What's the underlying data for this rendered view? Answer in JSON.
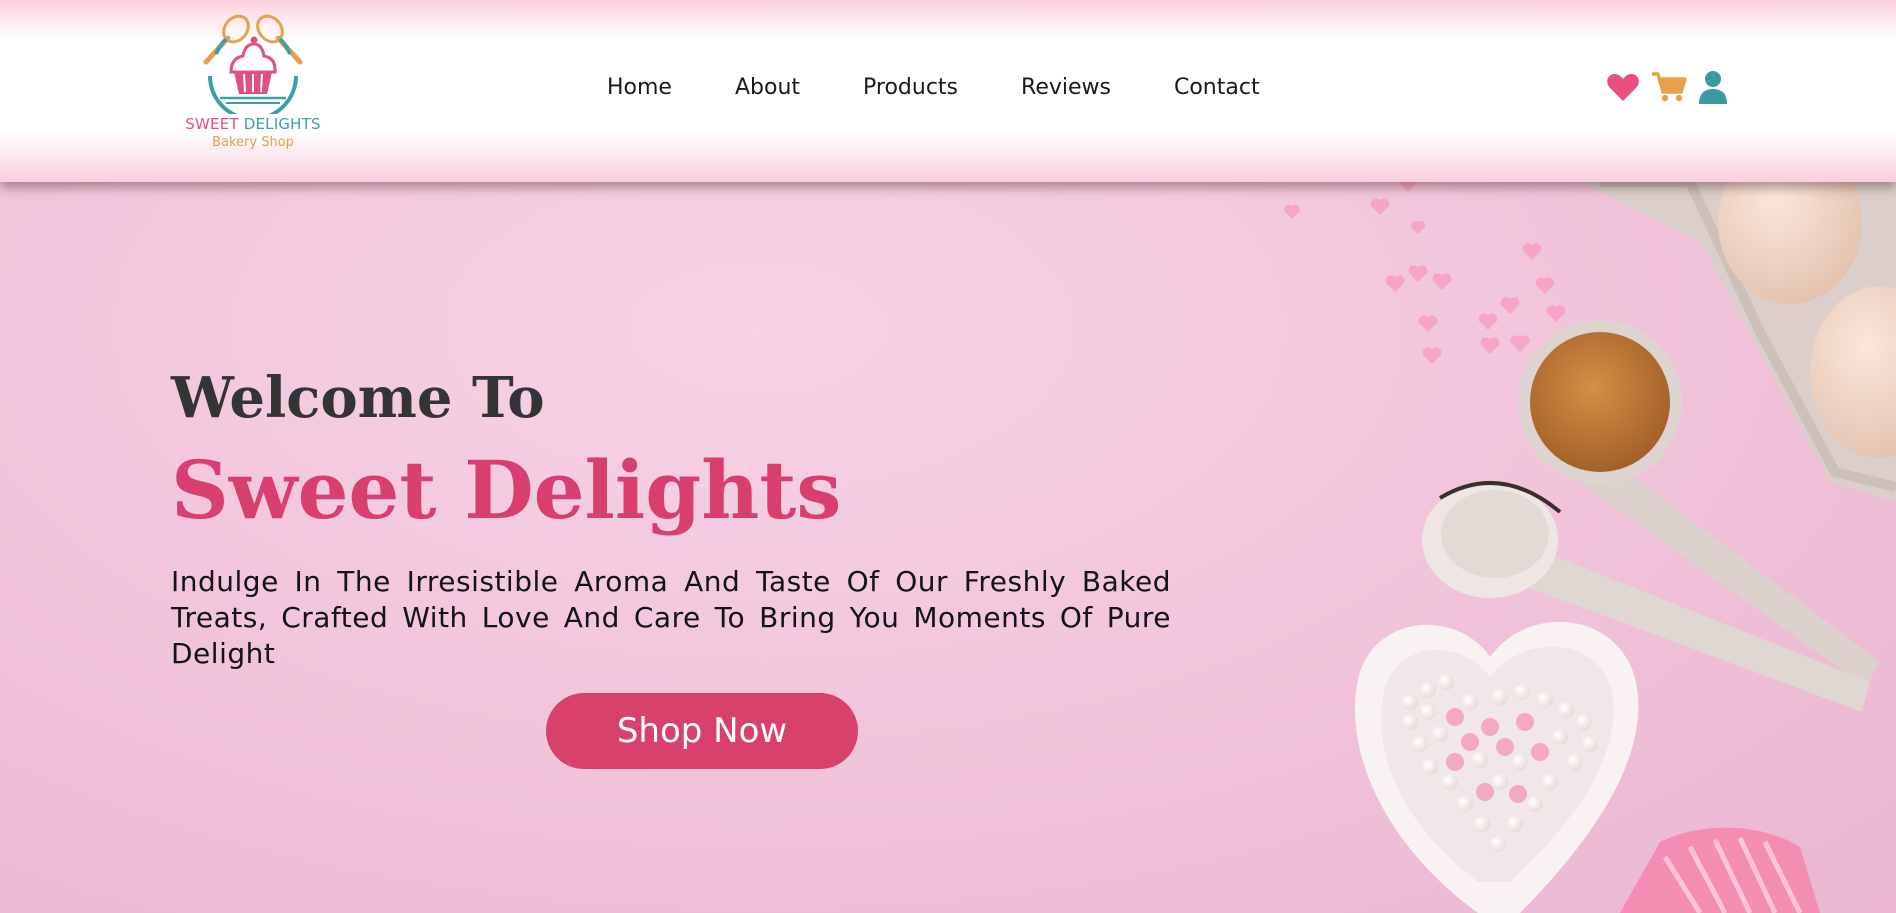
{
  "header": {
    "logo": {
      "name_part1": "SWEET ",
      "name_part2": "DELIGHTS",
      "subtitle": "Bakery Shop",
      "icon": "cupcake-whisk-logo-icon"
    },
    "nav": [
      "Home",
      "About",
      "Products",
      "Reviews",
      "Contact"
    ],
    "icons": [
      {
        "name": "heart-icon",
        "color": "#e8507f"
      },
      {
        "name": "cart-icon",
        "color": "#e6a14c"
      },
      {
        "name": "user-icon",
        "color": "#3a9aa0"
      }
    ]
  },
  "hero": {
    "title_line1": "Welcome To",
    "title_line2": "Sweet Delights",
    "description": "Indulge In The Irresistible Aroma And Taste Of Our Freshly Baked Treats, Crafted With Love And Care To Bring You Moments Of Pure Delight",
    "cta_label": "Shop Now"
  },
  "colors": {
    "accent": "#d9416d",
    "title_dark": "#343434",
    "hero_bg": "#f3c7dc"
  }
}
